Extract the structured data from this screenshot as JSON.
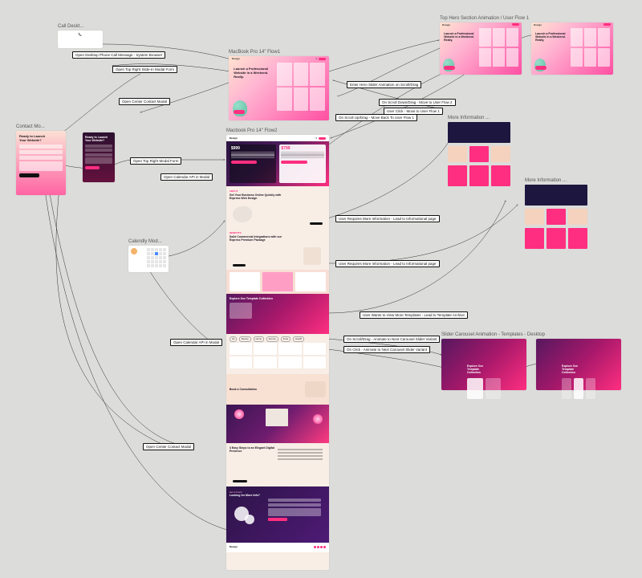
{
  "frames": {
    "call_desktop": {
      "title": "Call Deskt..."
    },
    "contact_modal": {
      "title": "Contact Mo...",
      "heading": "Ready to Launch\nYour Website?"
    },
    "calendly": {
      "title": "Calendly Mod..."
    },
    "flow1": {
      "title": "MacBook Pro 14\" Flow1",
      "brand": "Design",
      "heading": "Launch a Professional Website in a Weekend. Really."
    },
    "flow2": {
      "title": "Macbook Pro 14\" Flow2",
      "brand": "Design",
      "pricing": {
        "a": "$999",
        "b": "$799"
      },
      "sec1_eyebrow": "About",
      "sec1_heading": "Get Your Business Online Quickly with Express Web Design",
      "sec2_eyebrow": "Benefits",
      "sec2_heading": "Solid Commercial Integrations with our Express Premium Package",
      "templates_heading": "Explore Our Template Collection",
      "book_heading": "Book a Consultation",
      "steps_heading": "3 Easy Steps to an Elegant Digital Presence",
      "contact_eyebrow": "Get in Touch",
      "contact_heading": "Looking for More Info?",
      "footer_brand": "Design"
    },
    "hero_anim": {
      "title": "Top Hero Section Animation / User Flow 1",
      "brand": "Design",
      "heading": "Launch a Professional Website in a Weekend. Really."
    },
    "more_info_a": {
      "title": "More Information ..."
    },
    "more_info_b": {
      "title": "More Information ..."
    },
    "carousel": {
      "title": "Slider Carousel Animation - Templates - Desktop",
      "heading": "Explore Our Template Collection"
    },
    "dark_slide_heading": "Ready to Launch\nYour Website?"
  },
  "flow_labels": {
    "l1": "Open Desktop Phone Call Message - System Browser",
    "l2": "Open Top Right Slide-In Modal Form",
    "l3": "Open Center Contact Modal",
    "l4": "Open Top Right Modal Form",
    "l5": "Open Calendar API in Modal",
    "l6": "Open Calendar API in Modal",
    "l7": "Open Center Contact Modal",
    "l8": "Enter Hero Slider Animation on Scroll/Drag",
    "l9": "On Scroll Down/Drag - Move to User Flow 2",
    "l10": "On Scroll Up/Drag - Move Back To User Flow 1",
    "l11": "User Click - Move to User Flow 1",
    "l12": "User Requires More Information - Lead to Informational page",
    "l13": "User Requires More Information - Lead to Informational page",
    "l14": "User Wants to View More Templates - Lead to Template Archive",
    "l15": "On Scroll/Drag - Animate to Next Carousel Slider Variant",
    "l16": "On Click - Animate to Next Carousel Slider Variant"
  },
  "colors": {
    "magenta": "#ff2e80",
    "navy": "#1d1740",
    "peach": "#f4d2bd"
  }
}
